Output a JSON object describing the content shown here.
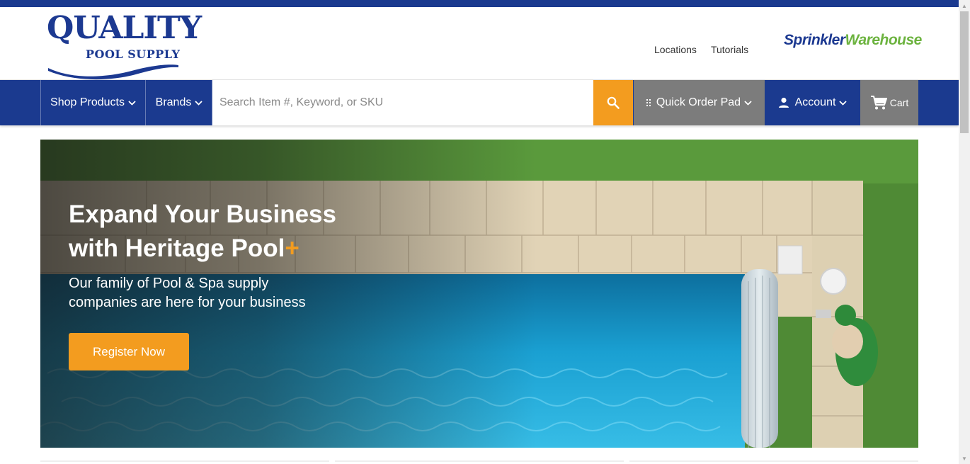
{
  "brand": {
    "logo_top": "QUALITY",
    "logo_bottom": "POOL SUPPLY",
    "partner_logo_a": "Sprinkler",
    "partner_logo_b": "Warehouse"
  },
  "header": {
    "links": [
      "Locations",
      "Tutorials"
    ]
  },
  "nav": {
    "shop_products": "Shop Products",
    "brands": "Brands",
    "search_placeholder": "Search Item #, Keyword, or SKU",
    "search_value": "",
    "quick_order_pad": "Quick Order Pad",
    "account": "Account",
    "cart": "Cart"
  },
  "hero": {
    "title_line1": "Expand Your Business",
    "title_line2": "with Heritage Pool",
    "title_plus": "+",
    "subtitle": "Our family of Pool & Spa supply companies  are here for your business",
    "cta": "Register Now"
  },
  "colors": {
    "primary_blue": "#1b3a8f",
    "accent_orange": "#f39c1f",
    "gray_button": "#7c7c7c",
    "partner_green": "#6cb33f"
  },
  "icons": [
    "chevron-down-icon",
    "search-icon",
    "grid-dots-icon",
    "user-icon",
    "cart-icon"
  ]
}
